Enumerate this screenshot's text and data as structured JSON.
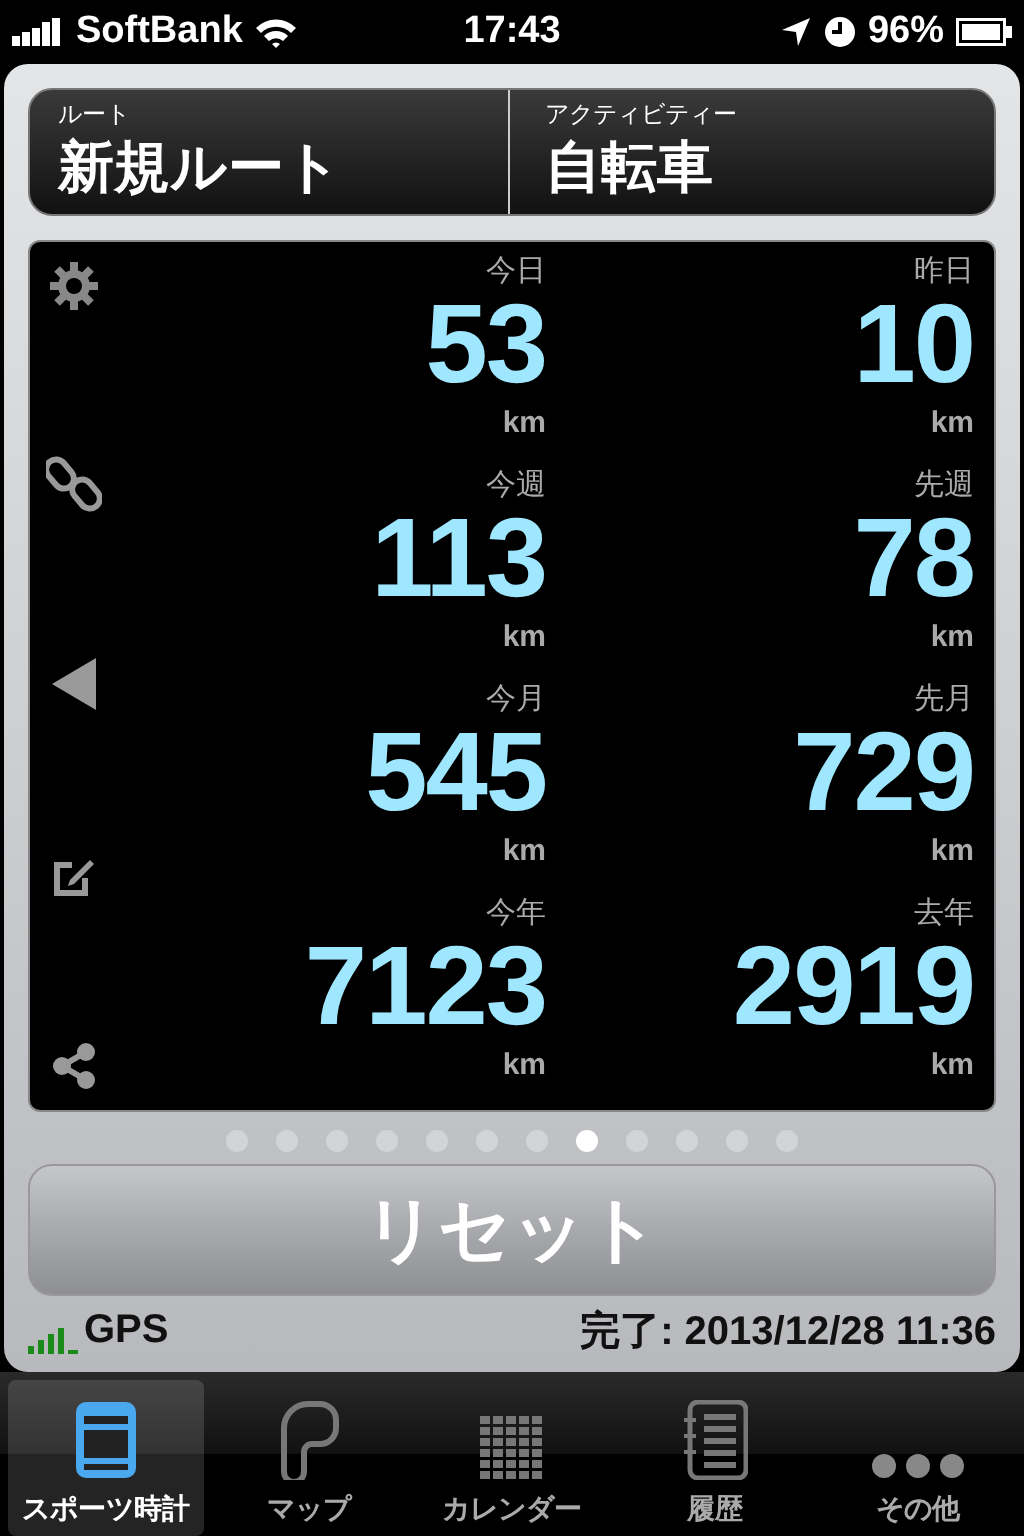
{
  "status_bar": {
    "carrier": "SoftBank",
    "time": "17:43",
    "battery": "96%"
  },
  "header": [
    {
      "label": "ルート",
      "value": "新規ルート"
    },
    {
      "label": "アクティビティー",
      "value": "自転車"
    }
  ],
  "stats": [
    {
      "label": "今日",
      "value": "53",
      "unit": "km"
    },
    {
      "label": "昨日",
      "value": "10",
      "unit": "km"
    },
    {
      "label": "今週",
      "value": "113",
      "unit": "km"
    },
    {
      "label": "先週",
      "value": "78",
      "unit": "km"
    },
    {
      "label": "今月",
      "value": "545",
      "unit": "km"
    },
    {
      "label": "先月",
      "value": "729",
      "unit": "km"
    },
    {
      "label": "今年",
      "value": "7123",
      "unit": "km"
    },
    {
      "label": "去年",
      "value": "2919",
      "unit": "km"
    }
  ],
  "page_dots": [
    {
      "selected": false
    },
    {
      "selected": false
    },
    {
      "selected": false
    },
    {
      "selected": false
    },
    {
      "selected": false
    },
    {
      "selected": false
    },
    {
      "selected": false
    },
    {
      "selected": true
    },
    {
      "selected": false
    },
    {
      "selected": false
    },
    {
      "selected": false
    },
    {
      "selected": false
    }
  ],
  "reset_button": "リセット",
  "gps": "GPS",
  "completed": "完了: 2013/12/28 11:36",
  "tabs": [
    {
      "kind": "watch",
      "label": "スポーツ時計",
      "selected": true
    },
    {
      "kind": "map",
      "label": "マップ",
      "selected": false
    },
    {
      "kind": "calendar",
      "label": "カレンダー",
      "selected": false
    },
    {
      "kind": "history",
      "label": "履歴",
      "selected": false
    },
    {
      "kind": "more",
      "label": "その他",
      "selected": false
    }
  ]
}
